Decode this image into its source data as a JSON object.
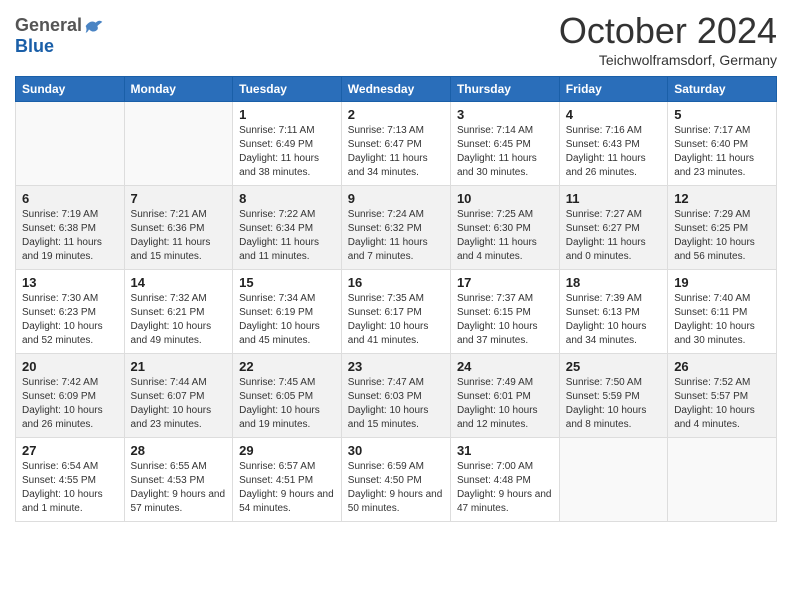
{
  "header": {
    "logo_general": "General",
    "logo_blue": "Blue",
    "month_title": "October 2024",
    "subtitle": "Teichwolframsdorf, Germany"
  },
  "weekdays": [
    "Sunday",
    "Monday",
    "Tuesday",
    "Wednesday",
    "Thursday",
    "Friday",
    "Saturday"
  ],
  "weeks": [
    [
      {
        "day": "",
        "sunrise": "",
        "sunset": "",
        "daylight": ""
      },
      {
        "day": "",
        "sunrise": "",
        "sunset": "",
        "daylight": ""
      },
      {
        "day": "1",
        "sunrise": "Sunrise: 7:11 AM",
        "sunset": "Sunset: 6:49 PM",
        "daylight": "Daylight: 11 hours and 38 minutes."
      },
      {
        "day": "2",
        "sunrise": "Sunrise: 7:13 AM",
        "sunset": "Sunset: 6:47 PM",
        "daylight": "Daylight: 11 hours and 34 minutes."
      },
      {
        "day": "3",
        "sunrise": "Sunrise: 7:14 AM",
        "sunset": "Sunset: 6:45 PM",
        "daylight": "Daylight: 11 hours and 30 minutes."
      },
      {
        "day": "4",
        "sunrise": "Sunrise: 7:16 AM",
        "sunset": "Sunset: 6:43 PM",
        "daylight": "Daylight: 11 hours and 26 minutes."
      },
      {
        "day": "5",
        "sunrise": "Sunrise: 7:17 AM",
        "sunset": "Sunset: 6:40 PM",
        "daylight": "Daylight: 11 hours and 23 minutes."
      }
    ],
    [
      {
        "day": "6",
        "sunrise": "Sunrise: 7:19 AM",
        "sunset": "Sunset: 6:38 PM",
        "daylight": "Daylight: 11 hours and 19 minutes."
      },
      {
        "day": "7",
        "sunrise": "Sunrise: 7:21 AM",
        "sunset": "Sunset: 6:36 PM",
        "daylight": "Daylight: 11 hours and 15 minutes."
      },
      {
        "day": "8",
        "sunrise": "Sunrise: 7:22 AM",
        "sunset": "Sunset: 6:34 PM",
        "daylight": "Daylight: 11 hours and 11 minutes."
      },
      {
        "day": "9",
        "sunrise": "Sunrise: 7:24 AM",
        "sunset": "Sunset: 6:32 PM",
        "daylight": "Daylight: 11 hours and 7 minutes."
      },
      {
        "day": "10",
        "sunrise": "Sunrise: 7:25 AM",
        "sunset": "Sunset: 6:30 PM",
        "daylight": "Daylight: 11 hours and 4 minutes."
      },
      {
        "day": "11",
        "sunrise": "Sunrise: 7:27 AM",
        "sunset": "Sunset: 6:27 PM",
        "daylight": "Daylight: 11 hours and 0 minutes."
      },
      {
        "day": "12",
        "sunrise": "Sunrise: 7:29 AM",
        "sunset": "Sunset: 6:25 PM",
        "daylight": "Daylight: 10 hours and 56 minutes."
      }
    ],
    [
      {
        "day": "13",
        "sunrise": "Sunrise: 7:30 AM",
        "sunset": "Sunset: 6:23 PM",
        "daylight": "Daylight: 10 hours and 52 minutes."
      },
      {
        "day": "14",
        "sunrise": "Sunrise: 7:32 AM",
        "sunset": "Sunset: 6:21 PM",
        "daylight": "Daylight: 10 hours and 49 minutes."
      },
      {
        "day": "15",
        "sunrise": "Sunrise: 7:34 AM",
        "sunset": "Sunset: 6:19 PM",
        "daylight": "Daylight: 10 hours and 45 minutes."
      },
      {
        "day": "16",
        "sunrise": "Sunrise: 7:35 AM",
        "sunset": "Sunset: 6:17 PM",
        "daylight": "Daylight: 10 hours and 41 minutes."
      },
      {
        "day": "17",
        "sunrise": "Sunrise: 7:37 AM",
        "sunset": "Sunset: 6:15 PM",
        "daylight": "Daylight: 10 hours and 37 minutes."
      },
      {
        "day": "18",
        "sunrise": "Sunrise: 7:39 AM",
        "sunset": "Sunset: 6:13 PM",
        "daylight": "Daylight: 10 hours and 34 minutes."
      },
      {
        "day": "19",
        "sunrise": "Sunrise: 7:40 AM",
        "sunset": "Sunset: 6:11 PM",
        "daylight": "Daylight: 10 hours and 30 minutes."
      }
    ],
    [
      {
        "day": "20",
        "sunrise": "Sunrise: 7:42 AM",
        "sunset": "Sunset: 6:09 PM",
        "daylight": "Daylight: 10 hours and 26 minutes."
      },
      {
        "day": "21",
        "sunrise": "Sunrise: 7:44 AM",
        "sunset": "Sunset: 6:07 PM",
        "daylight": "Daylight: 10 hours and 23 minutes."
      },
      {
        "day": "22",
        "sunrise": "Sunrise: 7:45 AM",
        "sunset": "Sunset: 6:05 PM",
        "daylight": "Daylight: 10 hours and 19 minutes."
      },
      {
        "day": "23",
        "sunrise": "Sunrise: 7:47 AM",
        "sunset": "Sunset: 6:03 PM",
        "daylight": "Daylight: 10 hours and 15 minutes."
      },
      {
        "day": "24",
        "sunrise": "Sunrise: 7:49 AM",
        "sunset": "Sunset: 6:01 PM",
        "daylight": "Daylight: 10 hours and 12 minutes."
      },
      {
        "day": "25",
        "sunrise": "Sunrise: 7:50 AM",
        "sunset": "Sunset: 5:59 PM",
        "daylight": "Daylight: 10 hours and 8 minutes."
      },
      {
        "day": "26",
        "sunrise": "Sunrise: 7:52 AM",
        "sunset": "Sunset: 5:57 PM",
        "daylight": "Daylight: 10 hours and 4 minutes."
      }
    ],
    [
      {
        "day": "27",
        "sunrise": "Sunrise: 6:54 AM",
        "sunset": "Sunset: 4:55 PM",
        "daylight": "Daylight: 10 hours and 1 minute."
      },
      {
        "day": "28",
        "sunrise": "Sunrise: 6:55 AM",
        "sunset": "Sunset: 4:53 PM",
        "daylight": "Daylight: 9 hours and 57 minutes."
      },
      {
        "day": "29",
        "sunrise": "Sunrise: 6:57 AM",
        "sunset": "Sunset: 4:51 PM",
        "daylight": "Daylight: 9 hours and 54 minutes."
      },
      {
        "day": "30",
        "sunrise": "Sunrise: 6:59 AM",
        "sunset": "Sunset: 4:50 PM",
        "daylight": "Daylight: 9 hours and 50 minutes."
      },
      {
        "day": "31",
        "sunrise": "Sunrise: 7:00 AM",
        "sunset": "Sunset: 4:48 PM",
        "daylight": "Daylight: 9 hours and 47 minutes."
      },
      {
        "day": "",
        "sunrise": "",
        "sunset": "",
        "daylight": ""
      },
      {
        "day": "",
        "sunrise": "",
        "sunset": "",
        "daylight": ""
      }
    ]
  ]
}
